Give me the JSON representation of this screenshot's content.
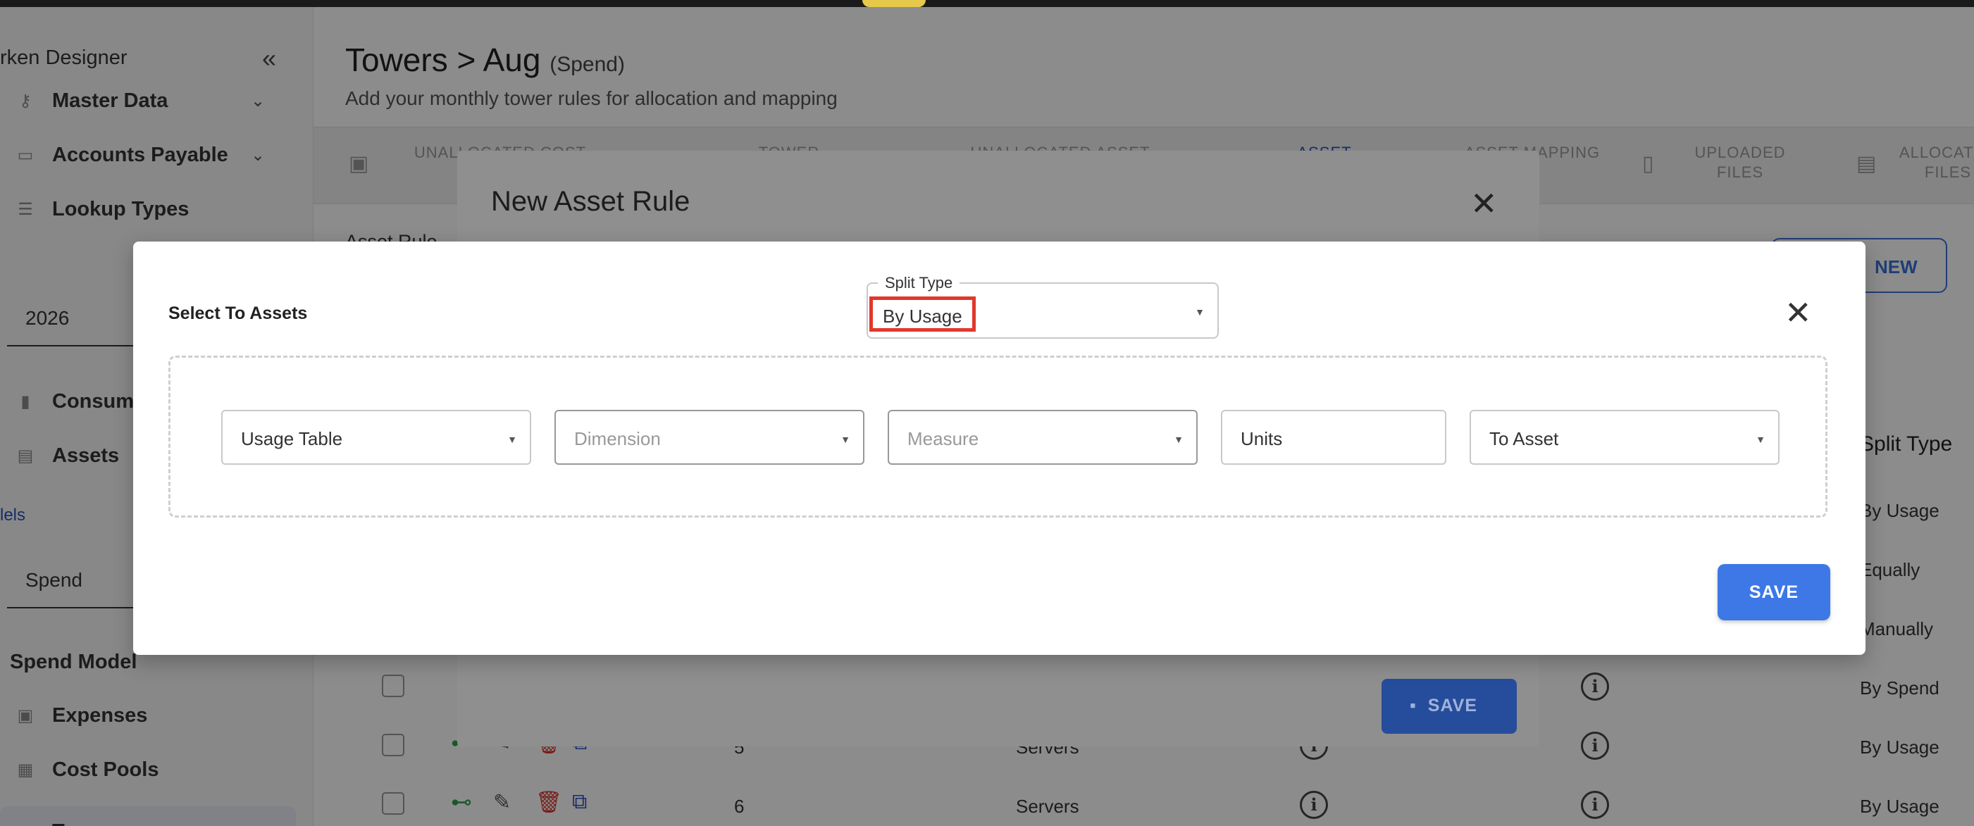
{
  "sidebar": {
    "title": "rken Designer",
    "items": [
      {
        "label": "Master Data",
        "icon": "key-icon"
      },
      {
        "label": "Accounts Payable",
        "icon": "card-icon"
      },
      {
        "label": "Lookup Types",
        "icon": "list-icon"
      },
      {
        "label": "Consum",
        "icon": "chart-icon"
      },
      {
        "label": "Assets",
        "icon": "stack-icon"
      }
    ],
    "year_value": "2026",
    "models_link": "lels",
    "view_value": "Spend",
    "section_title": "Spend Model",
    "model_items": [
      {
        "label": "Expenses"
      },
      {
        "label": "Cost Pools"
      },
      {
        "label": "Towers"
      }
    ]
  },
  "header": {
    "title": "Towers > Aug",
    "title_suffix": "(Spend)",
    "subtitle": "Add your monthly tower rules for allocation and mapping"
  },
  "tabs": [
    {
      "label": "UNALLOCATED COST POOL"
    },
    {
      "label": "TOWER"
    },
    {
      "label": "UNALLOCATED ASSET"
    },
    {
      "label": "ASSET"
    },
    {
      "label": "ASSET MAPPING"
    },
    {
      "label": "UPLOADED FILES"
    },
    {
      "label": "ALLOCATED FILES"
    }
  ],
  "asset_rules": {
    "label": "Asset Rule",
    "new_button": "NEW",
    "column_split_type": "Split Type",
    "rows": [
      {
        "num": "",
        "tower": "",
        "split": "By Usage"
      },
      {
        "num": "",
        "tower": "",
        "split": "Equally"
      },
      {
        "num": "",
        "tower": "",
        "split": "Manually"
      },
      {
        "num": "",
        "tower": "",
        "split": "By Spend"
      },
      {
        "num": "5",
        "tower": "Servers",
        "split": "By Usage"
      },
      {
        "num": "6",
        "tower": "Servers",
        "split": "By Usage"
      }
    ]
  },
  "new_asset_rule_dialog": {
    "title": "New Asset Rule",
    "save_label": "SAVE"
  },
  "select_assets_dialog": {
    "heading": "Select To Assets",
    "split_type_label": "Split Type",
    "split_type_value": "By Usage",
    "fields": {
      "usage_table": "Usage Table",
      "dimension": "Dimension",
      "measure": "Measure",
      "units": "Units",
      "to_asset": "To Asset"
    },
    "save_label": "SAVE"
  },
  "colors": {
    "accent": "#3d78e6",
    "highlight": "#e0382c",
    "toggle_on": "#2e9e4a",
    "delete": "#d9342b"
  }
}
